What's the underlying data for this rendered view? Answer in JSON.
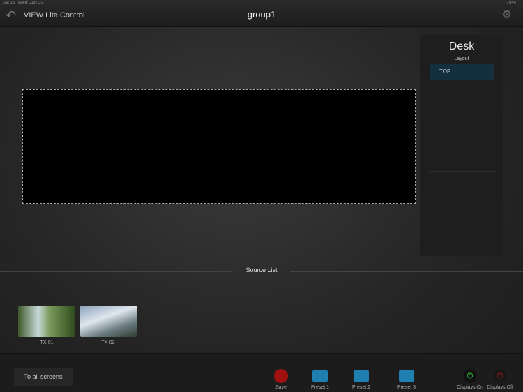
{
  "status": {
    "time": "09:25",
    "date": "Wed Jan 23",
    "battery": "78%"
  },
  "header": {
    "back_label": "VIEW Lite Control",
    "title": "group1"
  },
  "desk": {
    "title": "Desk",
    "layout_label": "Layout",
    "layouts": [
      "TOP"
    ]
  },
  "source_list": {
    "title": "Source List",
    "sources": [
      {
        "label": "TX-01"
      },
      {
        "label": "TX-02"
      }
    ]
  },
  "toolbar": {
    "to_all": "To all screens",
    "save": "Save",
    "preset1": "Preset 1",
    "preset2": "Preset 2",
    "preset3": "Preset 3",
    "displays_on": "Displays On",
    "displays_off": "Displays Off"
  },
  "colors": {
    "accent": "#1e7fb0",
    "save": "#a01010",
    "on": "#2ecc40",
    "off": "#9a1a1a"
  }
}
